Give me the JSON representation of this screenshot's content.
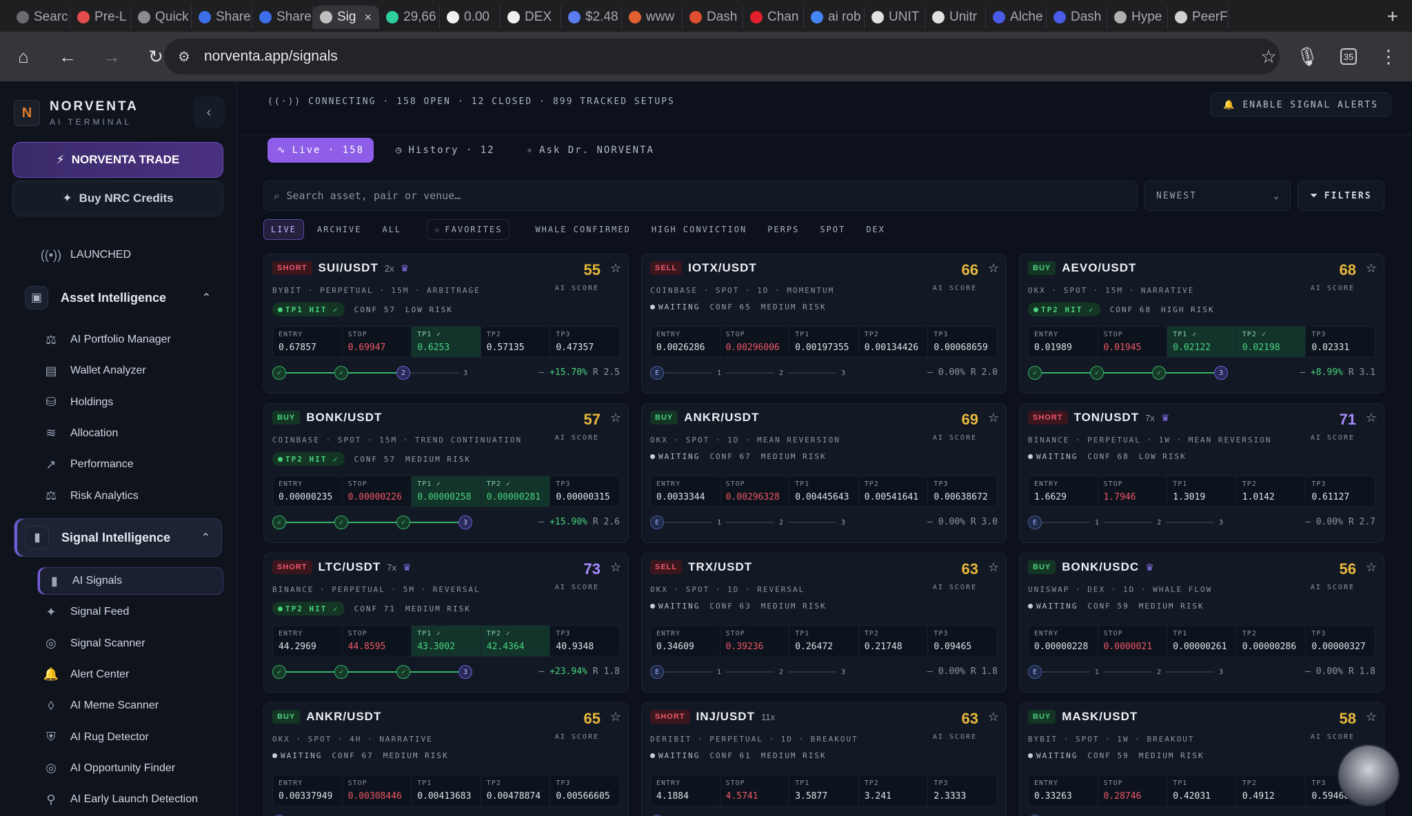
{
  "browser": {
    "tabs": [
      {
        "label": "Searc",
        "color": "#6a6a70"
      },
      {
        "label": "Pre-L",
        "color": "#e44b4b"
      },
      {
        "label": "Quick",
        "color": "#8a8a90"
      },
      {
        "label": "Share",
        "color": "#3b6ee8"
      },
      {
        "label": "Share",
        "color": "#3b6ee8"
      },
      {
        "label": "Sig",
        "color": "#c0c0c0",
        "active": true
      },
      {
        "label": "29,66",
        "color": "#2fd0a0"
      },
      {
        "label": "0.00",
        "color": "#f0f0f0"
      },
      {
        "label": "DEX",
        "color": "#f0f0f0"
      },
      {
        "label": "$2.48",
        "color": "#5b7bf0"
      },
      {
        "label": "www",
        "color": "#e06030"
      },
      {
        "label": "Dash",
        "color": "#e05030"
      },
      {
        "label": "Chan",
        "color": "#e0202a"
      },
      {
        "label": "ai rob",
        "color": "#4285f4"
      },
      {
        "label": "UNIT",
        "color": "#e0e0e0"
      },
      {
        "label": "Unitr",
        "color": "#e0e0e0"
      },
      {
        "label": "Alche",
        "color": "#4a5ce8"
      },
      {
        "label": "Dash",
        "color": "#4a5ce8"
      },
      {
        "label": "Hype",
        "color": "#b0b0b0"
      },
      {
        "label": "PeerF",
        "color": "#d0d0d0"
      }
    ],
    "url": "norventa.app/signals",
    "extension_badge": "35"
  },
  "sidebar": {
    "brand_name": "NORVENTA",
    "brand_sub": "AI TERMINAL",
    "trade_btn": "NORVENTA TRADE",
    "credits_btn": "Buy NRC Credits",
    "launched": "LAUNCHED",
    "section1": "Asset Intelligence",
    "items1": [
      "AI Portfolio Manager",
      "Wallet Analyzer",
      "Holdings",
      "Allocation",
      "Performance",
      "Risk Analytics"
    ],
    "section2": "Signal Intelligence",
    "items2": [
      "AI Signals",
      "Signal Feed",
      "Signal Scanner",
      "Alert Center",
      "AI Meme Scanner",
      "AI Rug Detector",
      "AI Opportunity Finder",
      "AI Early Launch Detection"
    ]
  },
  "status": {
    "connecting": "CONNECTING",
    "open": "158 OPEN",
    "closed": "12 CLOSED",
    "tracked": "899 TRACKED SETUPS",
    "alerts_btn": "ENABLE SIGNAL ALERTS"
  },
  "tabs": {
    "live": "Live · 158",
    "history": "History · 12",
    "ask": "Ask Dr. NORVENTA"
  },
  "search": {
    "placeholder": "Search asset, pair or venue…"
  },
  "sort": {
    "value": "NEWEST"
  },
  "filters_label": "FILTERS",
  "chips": [
    "LIVE",
    "ARCHIVE",
    "ALL",
    "FAVORITES",
    "WHALE CONFIRMED",
    "HIGH CONVICTION",
    "PERPS",
    "SPOT",
    "DEX"
  ],
  "labels": {
    "ai_score": "AI SCORE",
    "entry": "ENTRY",
    "stop": "STOP",
    "tp1": "TP1",
    "tp2": "TP2",
    "tp3": "TP3",
    "waiting": "WAITING"
  },
  "cards": [
    {
      "side": "SHORT",
      "pair": "SUI/USDT",
      "lev": "2x",
      "crown": true,
      "meta": "BYBIT · PERPETUAL · 15M · ARBITRAGE",
      "score": "55",
      "score_color": "y",
      "status": "TP1 HIT ✓",
      "conf": "CONF 57",
      "risk": "LOW RISK",
      "entry": "0.67857",
      "stop": "0.69947",
      "tp1": "0.6253",
      "tp2": "0.57135",
      "tp3": "0.47357",
      "tp_hit": 1,
      "pnl": "+15.70%",
      "rr": "R 2.5"
    },
    {
      "side": "SELL",
      "pair": "IOTX/USDT",
      "lev": "",
      "crown": false,
      "meta": "COINBASE · SPOT · 1D · MOMENTUM",
      "score": "66",
      "score_color": "y",
      "status": "WAITING",
      "conf": "CONF 65",
      "risk": "MEDIUM RISK",
      "entry": "0.0026286",
      "stop": "0.00296006",
      "tp1": "0.00197355",
      "tp2": "0.00134426",
      "tp3": "0.00068659",
      "tp_hit": 0,
      "pnl": "0.00%",
      "rr": "R 2.0"
    },
    {
      "side": "BUY",
      "pair": "AEVO/USDT",
      "lev": "",
      "crown": false,
      "meta": "OKX · SPOT · 15M · NARRATIVE",
      "score": "68",
      "score_color": "y",
      "status": "TP2 HIT ✓",
      "conf": "CONF 68",
      "risk": "HIGH RISK",
      "entry": "0.01989",
      "stop": "0.01945",
      "tp1": "0.02122",
      "tp2": "0.02198",
      "tp3": "0.02331",
      "tp_hit": 2,
      "pnl": "+8.99%",
      "rr": "R 3.1"
    },
    {
      "side": "BUY",
      "pair": "BONK/USDT",
      "lev": "",
      "crown": false,
      "meta": "COINBASE · SPOT · 15M · TREND CONTINUATION",
      "score": "57",
      "score_color": "y",
      "status": "TP2 HIT ✓",
      "conf": "CONF 57",
      "risk": "MEDIUM RISK",
      "entry": "0.00000235",
      "stop": "0.00000226",
      "tp1": "0.00000258",
      "tp2": "0.00000281",
      "tp3": "0.00000315",
      "tp_hit": 2,
      "pnl": "+15.90%",
      "rr": "R 2.6"
    },
    {
      "side": "BUY",
      "pair": "ANKR/USDT",
      "lev": "",
      "crown": false,
      "meta": "OKX · SPOT · 1D · MEAN REVERSION",
      "score": "69",
      "score_color": "y",
      "status": "WAITING",
      "conf": "CONF 67",
      "risk": "MEDIUM RISK",
      "entry": "0.0033344",
      "stop": "0.00296328",
      "tp1": "0.00445643",
      "tp2": "0.00541641",
      "tp3": "0.00638672",
      "tp_hit": 0,
      "pnl": "0.00%",
      "rr": "R 3.0"
    },
    {
      "side": "SHORT",
      "pair": "TON/USDT",
      "lev": "7x",
      "crown": true,
      "meta": "BINANCE · PERPETUAL · 1W · MEAN REVERSION",
      "score": "71",
      "score_color": "p",
      "status": "WAITING",
      "conf": "CONF 68",
      "risk": "LOW RISK",
      "entry": "1.6629",
      "stop": "1.7946",
      "tp1": "1.3019",
      "tp2": "1.0142",
      "tp3": "0.61127",
      "tp_hit": 0,
      "pnl": "0.00%",
      "rr": "R 2.7"
    },
    {
      "side": "SHORT",
      "pair": "LTC/USDT",
      "lev": "7x",
      "crown": true,
      "meta": "BINANCE · PERPETUAL · 5M · REVERSAL",
      "score": "73",
      "score_color": "p",
      "status": "TP2 HIT ✓",
      "conf": "CONF 71",
      "risk": "MEDIUM RISK",
      "entry": "44.2969",
      "stop": "44.8595",
      "tp1": "43.3002",
      "tp2": "42.4364",
      "tp3": "40.9348",
      "tp_hit": 2,
      "pnl": "+23.94%",
      "rr": "R 1.8"
    },
    {
      "side": "SELL",
      "pair": "TRX/USDT",
      "lev": "",
      "crown": false,
      "meta": "OKX · SPOT · 1D · REVERSAL",
      "score": "63",
      "score_color": "y",
      "status": "WAITING",
      "conf": "CONF 63",
      "risk": "MEDIUM RISK",
      "entry": "0.34609",
      "stop": "0.39236",
      "tp1": "0.26472",
      "tp2": "0.21748",
      "tp3": "0.09465",
      "tp_hit": 0,
      "pnl": "0.00%",
      "rr": "R 1.8"
    },
    {
      "side": "BUY",
      "pair": "BONK/USDC",
      "lev": "",
      "crown": true,
      "meta": "UNISWAP · DEX · 1D · WHALE FLOW",
      "score": "56",
      "score_color": "y",
      "status": "WAITING",
      "conf": "CONF 59",
      "risk": "MEDIUM RISK",
      "entry": "0.00000228",
      "stop": "0.0000021",
      "tp1": "0.00000261",
      "tp2": "0.00000286",
      "tp3": "0.00000327",
      "tp_hit": 0,
      "pnl": "0.00%",
      "rr": "R 1.8"
    },
    {
      "side": "BUY",
      "pair": "ANKR/USDT",
      "lev": "",
      "crown": false,
      "meta": "OKX · SPOT · 4H · NARRATIVE",
      "score": "65",
      "score_color": "y",
      "status": "WAITING",
      "conf": "CONF 67",
      "risk": "MEDIUM RISK",
      "entry": "0.00337949",
      "stop": "0.00308446",
      "tp1": "0.00413683",
      "tp2": "0.00478874",
      "tp3": "0.00566605",
      "tp_hit": 0,
      "pnl": "",
      "rr": ""
    },
    {
      "side": "SHORT",
      "pair": "INJ/USDT",
      "lev": "11x",
      "crown": false,
      "meta": "DERIBIT · PERPETUAL · 1D · BREAKOUT",
      "score": "63",
      "score_color": "y",
      "status": "WAITING",
      "conf": "CONF 61",
      "risk": "MEDIUM RISK",
      "entry": "4.1884",
      "stop": "4.5741",
      "tp1": "3.5877",
      "tp2": "3.241",
      "tp3": "2.3333",
      "tp_hit": 0,
      "pnl": "",
      "rr": ""
    },
    {
      "side": "BUY",
      "pair": "MASK/USDT",
      "lev": "",
      "crown": false,
      "meta": "BYBIT · SPOT · 1W · BREAKOUT",
      "score": "58",
      "score_color": "y",
      "status": "WAITING",
      "conf": "CONF 59",
      "risk": "MEDIUM RISK",
      "entry": "0.33263",
      "stop": "0.28746",
      "tp1": "0.42031",
      "tp2": "0.4912",
      "tp3": "0.59468",
      "tp_hit": 0,
      "pnl": "",
      "rr": ""
    }
  ],
  "colors": {
    "accent": "#8e5ee8",
    "buy": "#4ad37e",
    "sell": "#f0566d",
    "score_yellow": "#e9b83c",
    "score_purple": "#a88cff"
  }
}
